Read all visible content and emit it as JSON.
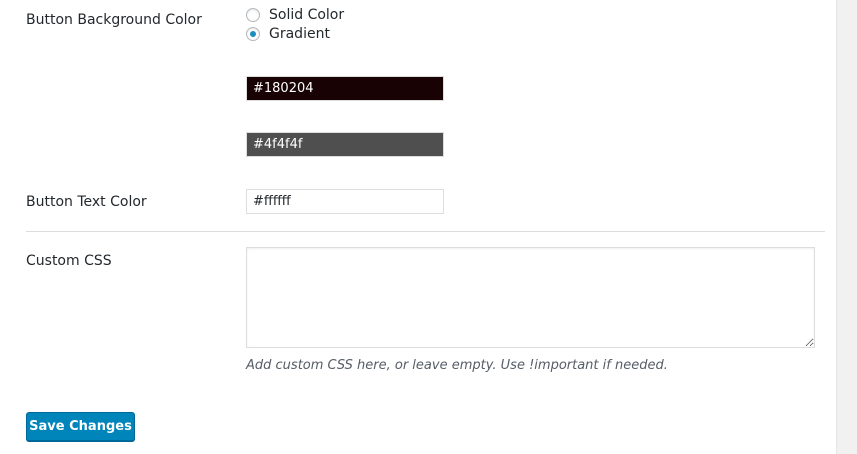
{
  "form": {
    "button_background_color": {
      "label": "Button Background Color",
      "options": [
        {
          "label": "Solid Color",
          "checked": false
        },
        {
          "label": "Gradient",
          "checked": true
        }
      ],
      "gradient_start": {
        "value": "#180204"
      },
      "gradient_end": {
        "value": "#4f4f4f"
      }
    },
    "button_text_color": {
      "label": "Button Text Color",
      "value": "#ffffff"
    },
    "custom_css": {
      "label": "Custom CSS",
      "value": "",
      "description": "Add custom CSS here, or leave empty. Use !important if needed."
    }
  },
  "actions": {
    "save_label": "Save Changes"
  },
  "colors": {
    "primary_button": "#0085ba",
    "radio_checked": "#1e8cbe",
    "gradient_start_swatch": "#180204",
    "gradient_end_swatch": "#4f4f4f",
    "text_color_swatch": "#ffffff"
  }
}
